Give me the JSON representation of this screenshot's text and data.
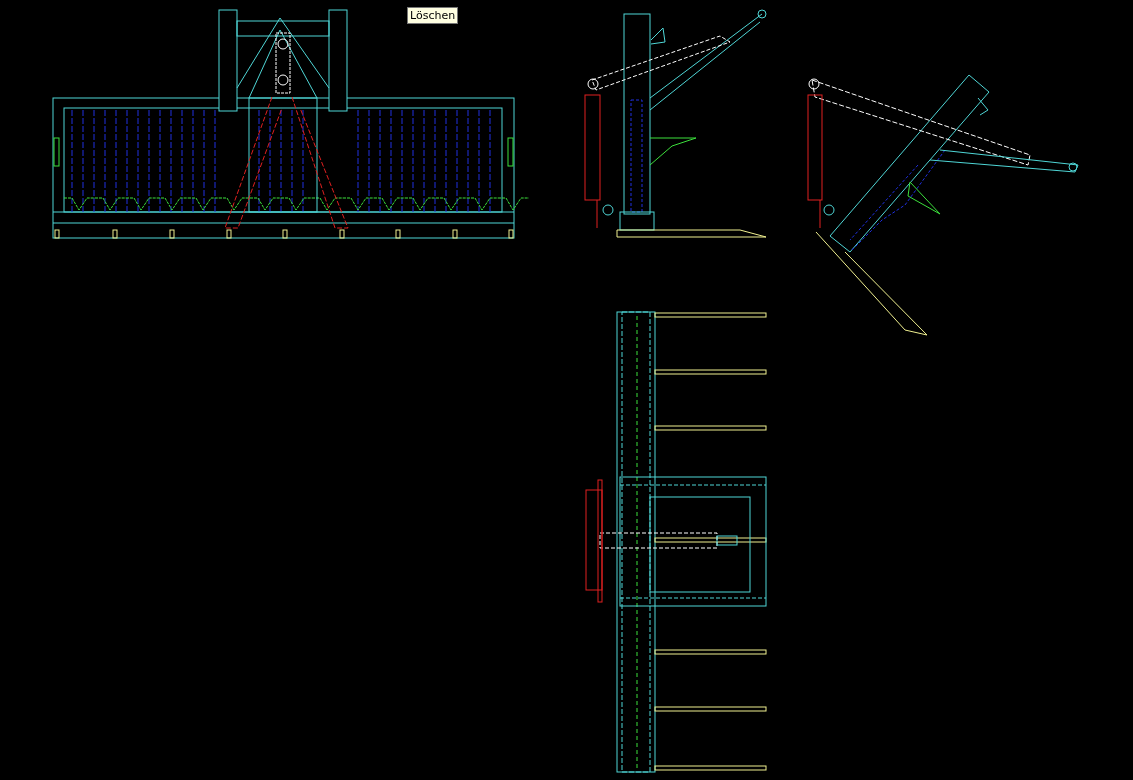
{
  "tooltip": {
    "text": "Löschen"
  }
}
